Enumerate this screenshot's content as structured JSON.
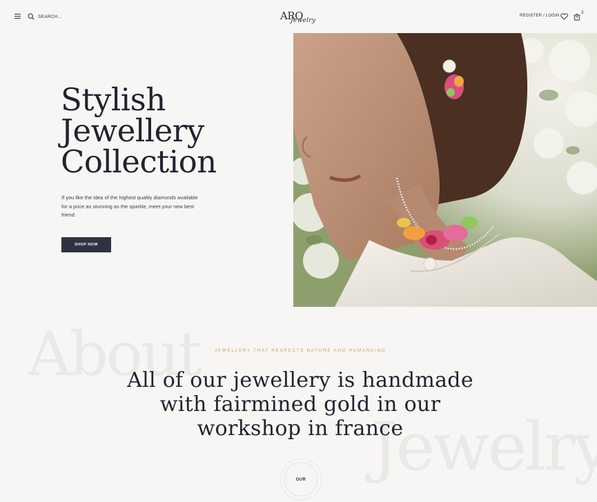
{
  "header": {
    "logo_main": "ARO",
    "logo_script": "Jewelry",
    "search_placeholder": "SEARCH...",
    "auth_label": "REGISTER / LOGIN",
    "cart_count": "3"
  },
  "hero": {
    "title_lines": [
      "Stylish",
      "Jewellery",
      "Collection"
    ],
    "description": "If you like the idea of the highest quality diamonds available for a price as stunning as the sparkle, meet your new best friend.",
    "cta_label": "SHOP NOW"
  },
  "about": {
    "bg_word_left": "About",
    "bg_word_right": "Jewelry",
    "eyebrow": "JEWELLERY THAT RESPECTS NATURE AND HUMANKIND",
    "heading_lines": [
      "All of our jewellery is handmade",
      "with fairmined gold in our",
      "workshop in france"
    ],
    "badge_text": "OUR"
  },
  "colors": {
    "background": "#f7f6f4",
    "text_dark": "#1f2430",
    "button_bg": "#2f3341",
    "accent_gold": "#c8a15a",
    "bg_word": "#ebe9e5"
  },
  "icons": [
    "menu-icon",
    "search-icon",
    "heart-icon",
    "cart-icon"
  ]
}
